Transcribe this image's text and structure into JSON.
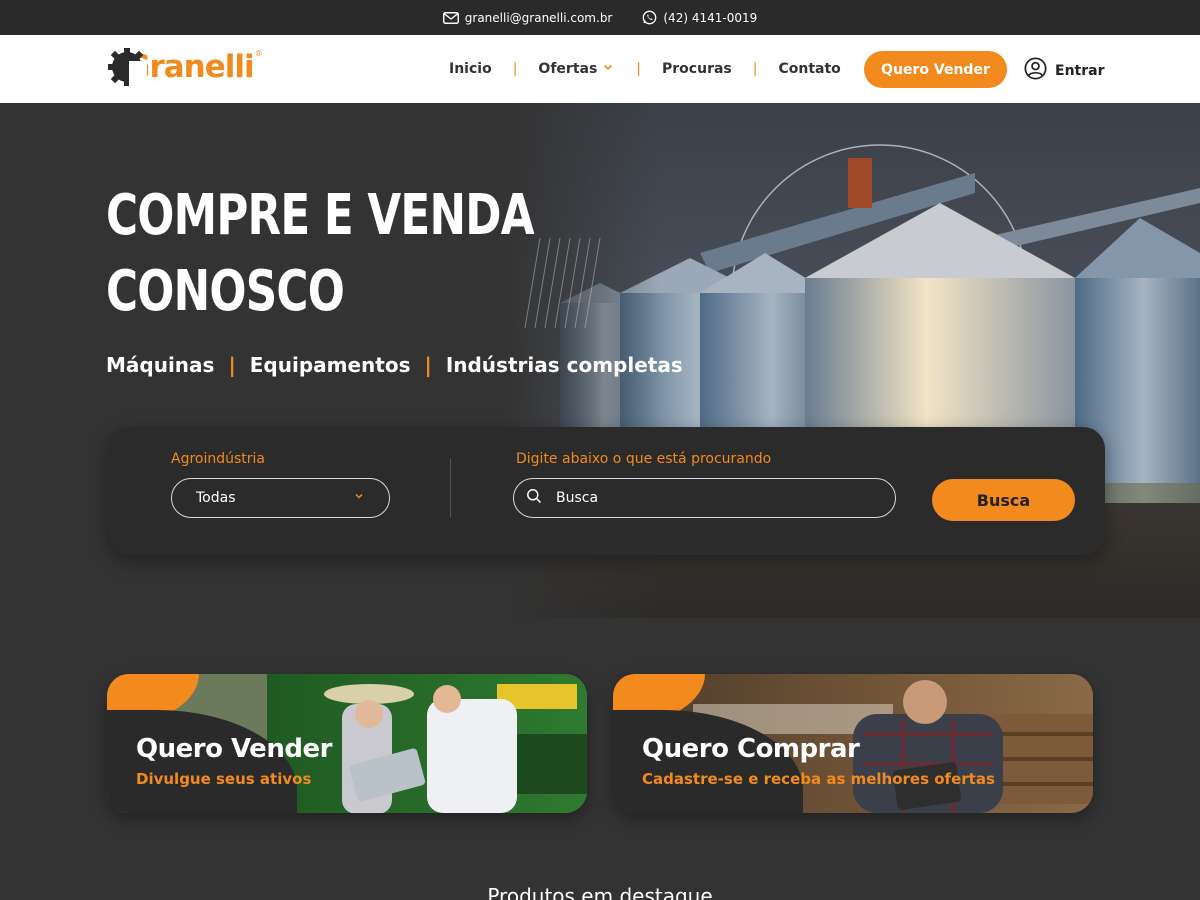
{
  "topbar": {
    "email": "granelli@granelli.com.br",
    "phone": "(42) 4141-0019"
  },
  "header": {
    "logo_text": "Granelli",
    "logo_mark": "®",
    "nav": [
      {
        "label": "Inicio"
      },
      {
        "label": "Ofertas"
      },
      {
        "label": "Procuras"
      },
      {
        "label": "Contato"
      }
    ],
    "sell_button": "Quero Vender",
    "login_label": "Entrar"
  },
  "hero": {
    "title_line1": "Compre e venda",
    "title_line2": "conosco",
    "categories": [
      "Máquinas",
      "Equipamentos",
      "Indústrias completas"
    ]
  },
  "search": {
    "agro_label": "Agroindústria",
    "agro_selected": "Todas",
    "query_label": "Digite abaixo o que está procurando",
    "query_placeholder": "Busca",
    "button_label": "Busca"
  },
  "cards": {
    "sell": {
      "title": "Quero Vender",
      "subtitle": "Divulgue seus ativos"
    },
    "buy": {
      "title": "Quero Comprar",
      "subtitle": "Cadastre-se e receba as melhores ofertas"
    }
  },
  "featured": {
    "title": "Produtos em destaque"
  },
  "colors": {
    "accent": "#f28a1e",
    "background": "#333333",
    "topbar": "#2a2a2a",
    "panel": "#2b2b2b"
  }
}
